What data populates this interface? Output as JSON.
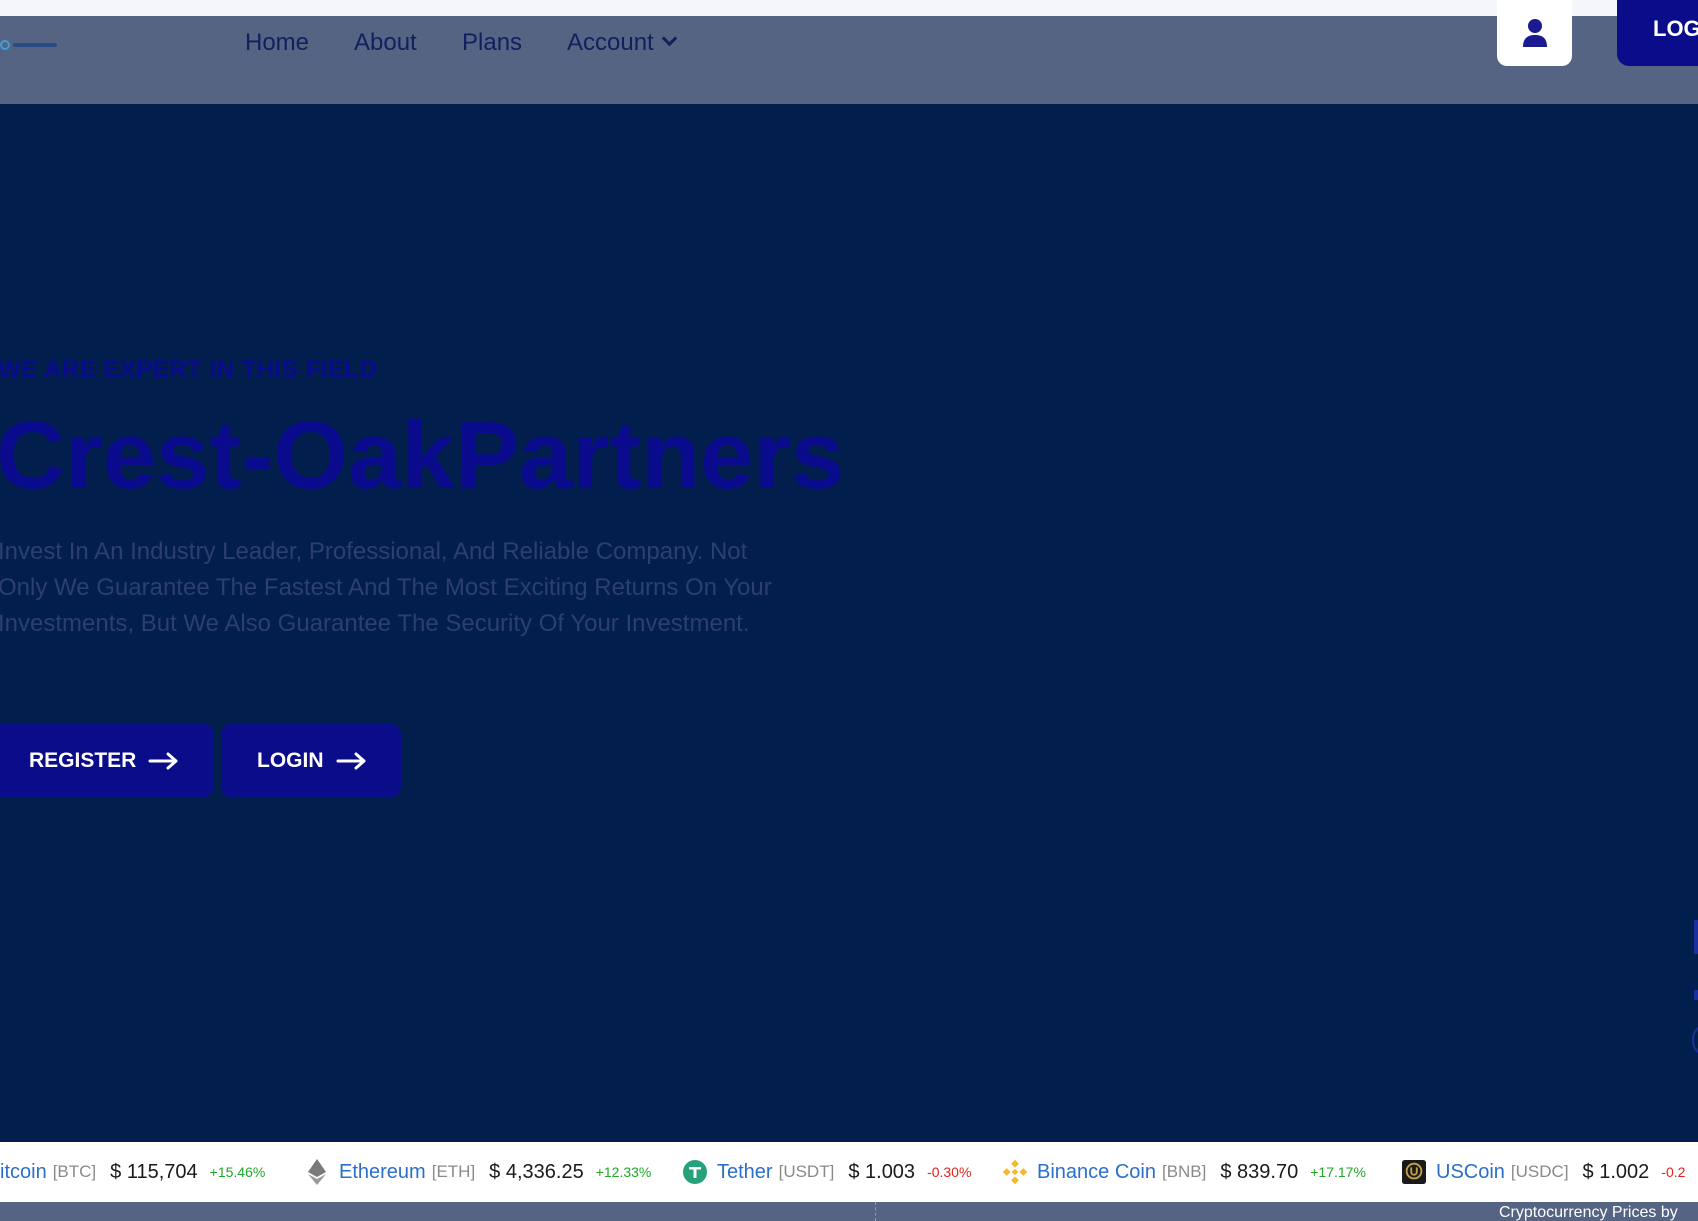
{
  "nav": {
    "items": [
      {
        "label": "Home"
      },
      {
        "label": "About"
      },
      {
        "label": "Plans"
      },
      {
        "label": "Account"
      }
    ],
    "login_label": "LOG"
  },
  "hero": {
    "kicker": "WE ARE EXPERT IN THIS FIELD",
    "title": "Crest-OakPartners",
    "description": "Invest In An Industry Leader, Professional, And Reliable Company. Not Only We Guarantee The Fastest And The Most Exciting Returns On Your Investments, But We Also Guarantee The Security Of Your Investment.",
    "register_label": "REGISTER",
    "login_label": "LOGIN"
  },
  "ticker": [
    {
      "name": "itcoin",
      "symbol": "[BTC]",
      "price": "$ 115,704",
      "change": "+15.46%",
      "direction": "up",
      "icon": "bitcoin-icon"
    },
    {
      "name": "Ethereum",
      "symbol": "[ETH]",
      "price": "$ 4,336.25",
      "change": "+12.33%",
      "direction": "up",
      "icon": "ethereum-icon"
    },
    {
      "name": "Tether",
      "symbol": "[USDT]",
      "price": "$ 1.003",
      "change": "-0.30%",
      "direction": "down",
      "icon": "tether-icon"
    },
    {
      "name": "Binance Coin",
      "symbol": "[BNB]",
      "price": "$ 839.70",
      "change": "+17.17%",
      "direction": "up",
      "icon": "binance-coin-icon"
    },
    {
      "name": "USCoin",
      "symbol": "[USDC]",
      "price": "$ 1.002",
      "change": "-0.2",
      "direction": "down",
      "icon": "uscoin-icon"
    }
  ],
  "footer": {
    "attribution": "Cryptocurrency Prices by"
  },
  "colors": {
    "background": "#011e4d",
    "navbar": "#556482",
    "accent": "#0a0c8a",
    "positive": "#21a629",
    "negative": "#e0241c"
  }
}
